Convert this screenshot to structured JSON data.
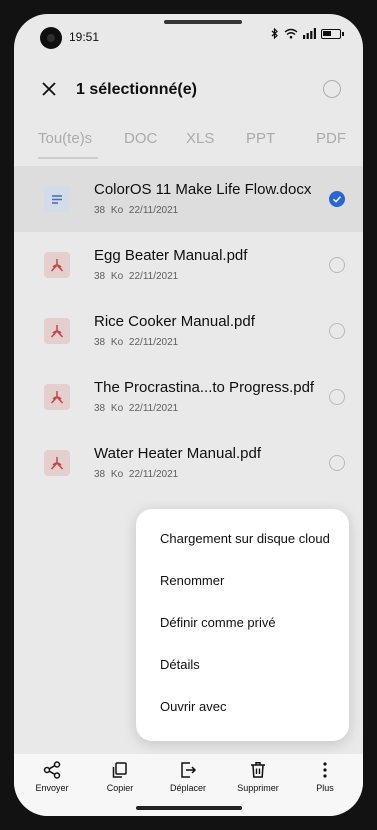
{
  "status_bar": {
    "time": "19:51",
    "icons": [
      "bluetooth-icon",
      "wifi-icon",
      "signal-icon",
      "battery-icon"
    ]
  },
  "header": {
    "title": "1 sélectionné(e)"
  },
  "tabs": [
    {
      "label": "Tou(te)s"
    },
    {
      "label": "DOC"
    },
    {
      "label": "XLS"
    },
    {
      "label": "PPT"
    },
    {
      "label": "PDF"
    }
  ],
  "files": [
    {
      "name": "ColorOS 11 Make Life Flow.docx",
      "size": "38 Ko",
      "date": "22/11/2021",
      "type": "doc",
      "selected": true
    },
    {
      "name": "Egg Beater Manual.pdf",
      "size": "38 Ko",
      "date": "22/11/2021",
      "type": "pdf",
      "selected": false
    },
    {
      "name": "Rice Cooker Manual.pdf",
      "size": "38 Ko",
      "date": "22/11/2021",
      "type": "pdf",
      "selected": false
    },
    {
      "name": "The Procrastina...to Progress.pdf",
      "size": "38 Ko",
      "date": "22/11/2021",
      "type": "pdf",
      "selected": false
    },
    {
      "name": "Water Heater Manual.pdf",
      "size": "38 Ko",
      "date": "22/11/2021",
      "type": "pdf",
      "selected": false
    }
  ],
  "menu": {
    "items": [
      {
        "label": "Chargement sur disque cloud"
      },
      {
        "label": "Renommer"
      },
      {
        "label": "Définir comme privé"
      },
      {
        "label": "Détails"
      },
      {
        "label": "Ouvrir avec"
      }
    ]
  },
  "bottom_bar": {
    "items": [
      {
        "label": "Envoyer",
        "icon": "share-icon"
      },
      {
        "label": "Copier",
        "icon": "copy-icon"
      },
      {
        "label": "Déplacer",
        "icon": "move-icon"
      },
      {
        "label": "Supprimer",
        "icon": "trash-icon"
      },
      {
        "label": "Plus",
        "icon": "more-icon"
      }
    ]
  },
  "colors": {
    "accent": "#2f6ee0",
    "pdf_red": "#d94a4a",
    "doc_blue": "#3e76e3"
  }
}
